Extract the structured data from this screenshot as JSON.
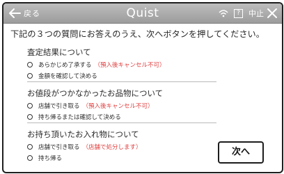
{
  "header": {
    "back_label": "戻る",
    "app_title": "Quist",
    "help_label": "?",
    "cancel_label": "中止"
  },
  "instruction": "下記の３つの質問にお答えのうえ、次へボタンを押してください。",
  "questions": [
    {
      "title": "査定結果について",
      "options": [
        {
          "label": "あらかじめ了承する",
          "note": "（預入後キャンセル不可）"
        },
        {
          "label": "金額を確認して決める",
          "note": ""
        }
      ]
    },
    {
      "title": "お値段がつかなかったお品物について",
      "options": [
        {
          "label": "店舗で引き取る",
          "note": "（預入後キャンセル不可）"
        },
        {
          "label": "持ち帰るまたは確認して決める",
          "note": ""
        }
      ]
    },
    {
      "title": "お持ち頂いたお入れ物について",
      "options": [
        {
          "label": "店舗で引き取る",
          "note": "（店舗で処分します）"
        },
        {
          "label": "持ち帰る",
          "note": ""
        }
      ]
    }
  ],
  "next_label": "次へ",
  "colors": {
    "header": "#a8a8a8",
    "note": "#e03c3c"
  },
  "icons": [
    "back-arrow-icon",
    "wifi-icon",
    "help-icon",
    "close-icon"
  ]
}
